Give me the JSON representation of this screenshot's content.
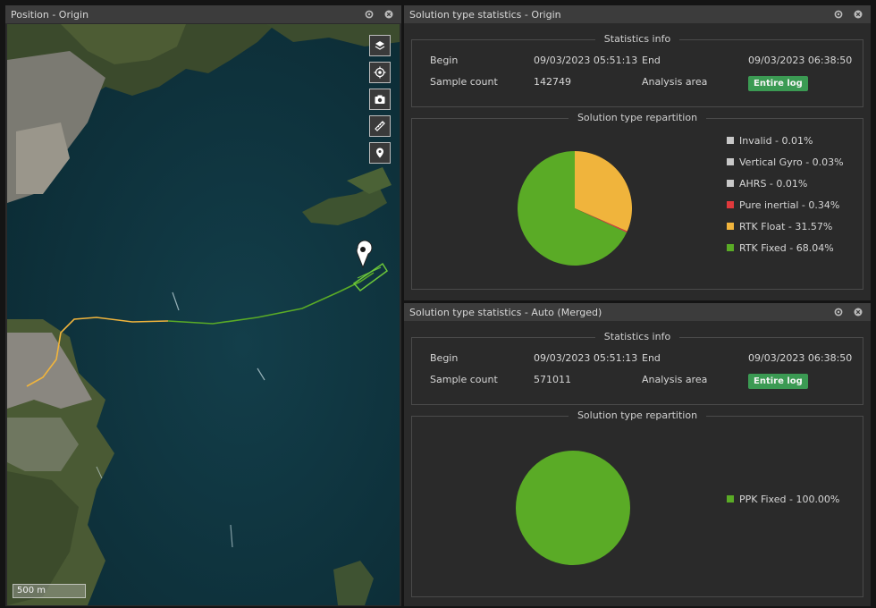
{
  "map_pane": {
    "title": "Position - Origin",
    "scale_label": "500 m",
    "tools": [
      "layers-icon",
      "locate-icon",
      "camera-icon",
      "ruler-icon",
      "marker-icon"
    ]
  },
  "stats_origin": {
    "title": "Solution type statistics - Origin",
    "info_heading": "Statistics info",
    "begin_label": "Begin",
    "begin_value": "09/03/2023 05:51:13",
    "end_label": "End",
    "end_value": "09/03/2023 06:38:50",
    "count_label": "Sample count",
    "count_value": "142749",
    "area_label": "Analysis area",
    "area_value": "Entire log",
    "repartition_heading": "Solution type repartition",
    "slices": [
      {
        "label": "Invalid - 0.01%",
        "value": 0.01,
        "color": "#c8c8c8"
      },
      {
        "label": "Vertical Gyro - 0.03%",
        "value": 0.03,
        "color": "#c8c8c8"
      },
      {
        "label": "AHRS - 0.01%",
        "value": 0.01,
        "color": "#c8c8c8"
      },
      {
        "label": "Pure inertial - 0.34%",
        "value": 0.34,
        "color": "#e0393c"
      },
      {
        "label": "RTK Float - 31.57%",
        "value": 31.57,
        "color": "#f0b43c"
      },
      {
        "label": "RTK Fixed - 68.04%",
        "value": 68.04,
        "color": "#5aab26"
      }
    ]
  },
  "stats_merged": {
    "title": "Solution type statistics - Auto (Merged)",
    "info_heading": "Statistics info",
    "begin_label": "Begin",
    "begin_value": "09/03/2023 05:51:13",
    "end_label": "End",
    "end_value": "09/03/2023 06:38:50",
    "count_label": "Sample count",
    "count_value": "571011",
    "area_label": "Analysis area",
    "area_value": "Entire log",
    "repartition_heading": "Solution type repartition",
    "slices": [
      {
        "label": "PPK Fixed - 100.00%",
        "value": 100.0,
        "color": "#5aab26"
      }
    ]
  }
}
